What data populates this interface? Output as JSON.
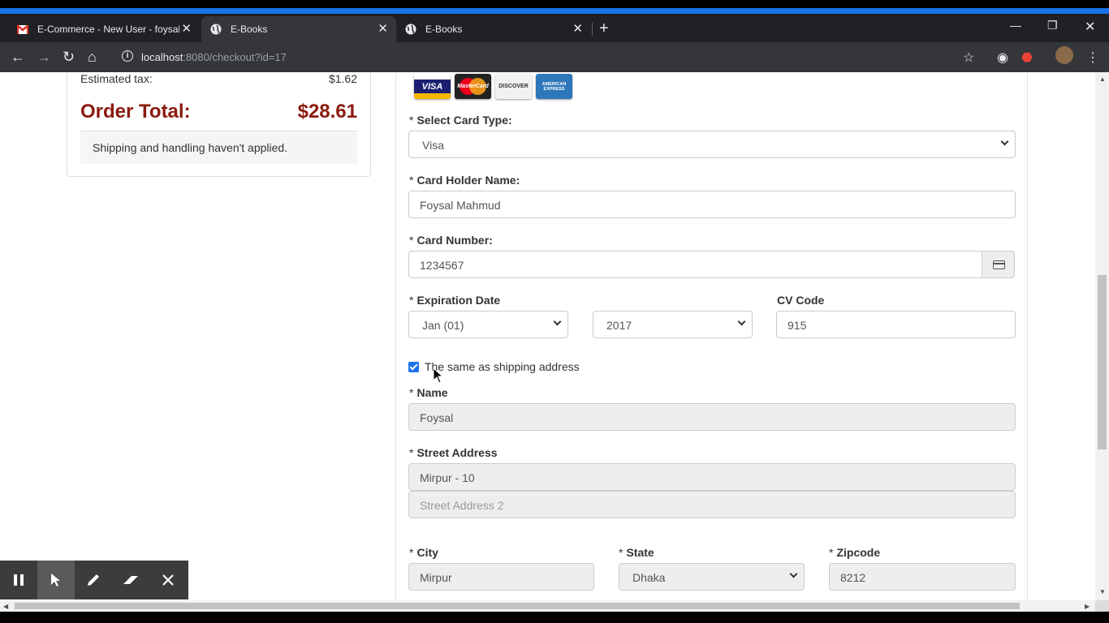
{
  "browser": {
    "tabs": [
      {
        "title": "E-Commerce - New User - foysal",
        "icon": "gmail-icon"
      },
      {
        "title": "E-Books",
        "icon": "globe-icon"
      },
      {
        "title": "E-Books",
        "icon": "globe-icon"
      }
    ],
    "url_host": "localhost",
    "url_rest": ":8080/checkout?id=17"
  },
  "summary": {
    "estimated_tax_label": "Estimated tax:",
    "estimated_tax_value": "$1.62",
    "order_total_label": "Order Total:",
    "order_total_value": "$28.61",
    "shipping_note": "Shipping and handling haven't applied."
  },
  "card_logos": [
    "VISA",
    "MasterCard",
    "DISCOVER",
    "AMERICAN EXPRESS"
  ],
  "form": {
    "card_type_label": "Select Card Type:",
    "card_type_value": "Visa",
    "holder_label": "Card Holder Name:",
    "holder_value": "Foysal Mahmud",
    "number_label": "Card Number:",
    "number_value": "1234567",
    "expiration_label": "Expiration Date",
    "exp_month": "Jan (01)",
    "exp_year": "2017",
    "cv_label": "CV Code",
    "cv_value": "915",
    "same_as_shipping": "The same as shipping address",
    "name_label": "Name",
    "name_value": "Foysal",
    "street_label": "Street Address",
    "street_value": "Mirpur - 10",
    "street2_placeholder": "Street Address 2",
    "city_label": "City",
    "city_value": "Mirpur",
    "state_label": "State",
    "state_value": "Dhaka",
    "zip_label": "Zipcode",
    "zip_value": "8212",
    "required_mark": "*"
  },
  "colors": {
    "accent": "#1a73e8",
    "order_total": "#8b1a0e"
  }
}
